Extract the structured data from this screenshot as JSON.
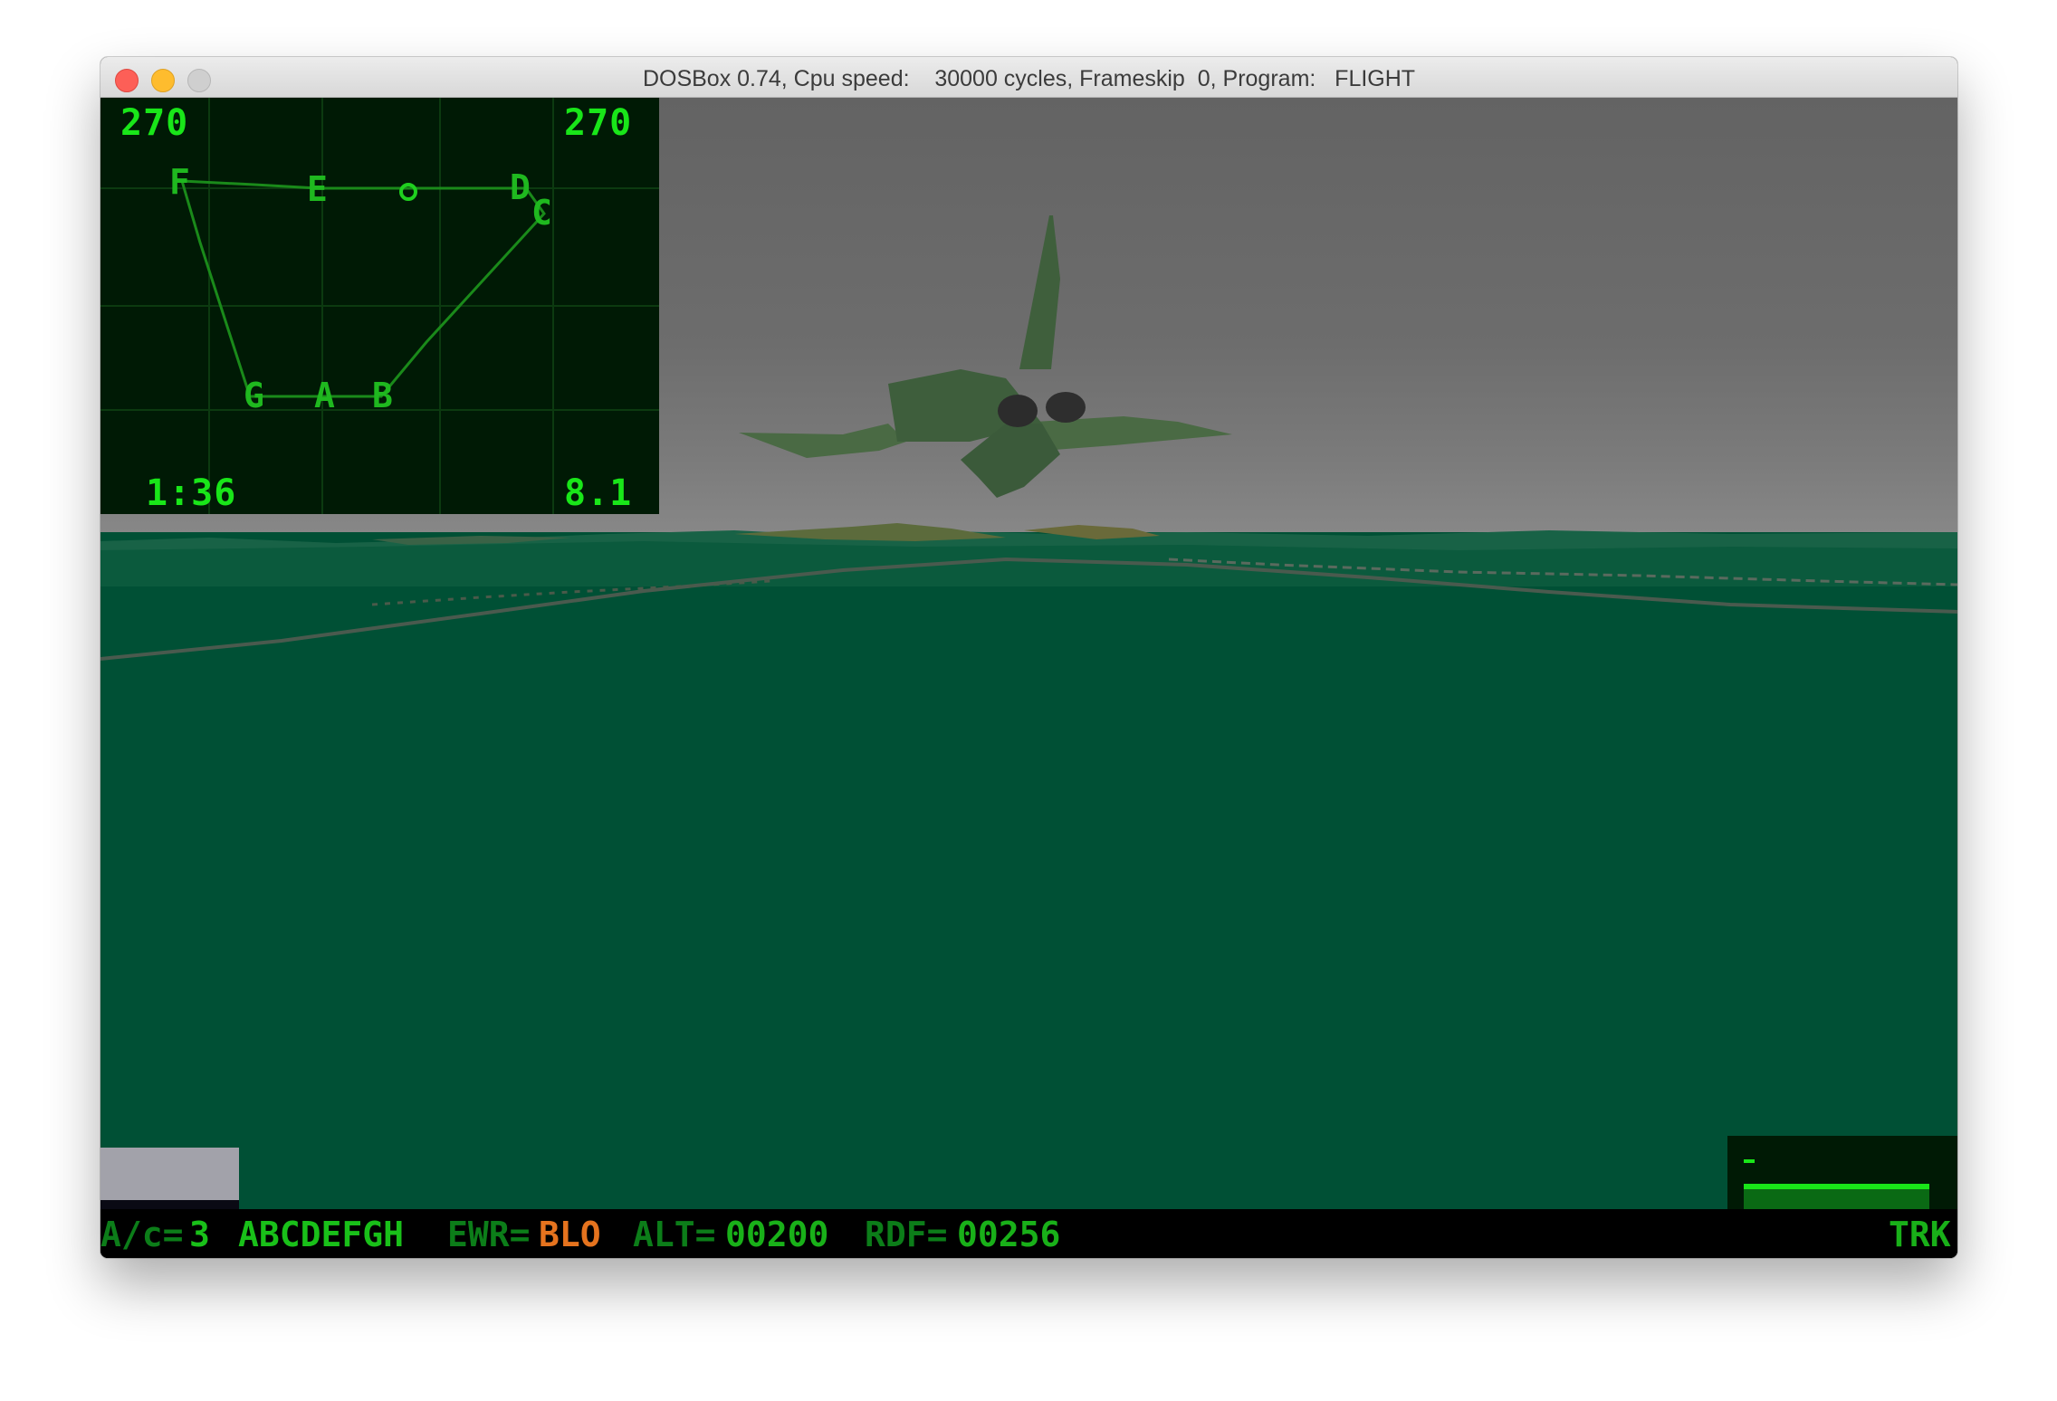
{
  "window": {
    "title": "DOSBox 0.74, Cpu speed:    30000 cycles, Frameskip  0, Program:   FLIGHT"
  },
  "map_panel": {
    "heading_left": "270",
    "heading_right": "270",
    "time": "1:36",
    "value": "8.1",
    "waypoints": [
      "F",
      "E",
      "D",
      "C",
      "G",
      "A",
      "B"
    ]
  },
  "status_bar": {
    "aircraft_label": "A/c=",
    "aircraft_value": "3",
    "weapons": "ABCDEFGH",
    "ewr_label": "EWR=",
    "ewr_value": "BLO",
    "alt_label": "ALT=",
    "alt_value": "00200",
    "rdf_label": "RDF=",
    "rdf_value": "00256",
    "mode": "TRK"
  },
  "colors": {
    "hud_green": "#19e619",
    "status_green": "#0c7d19",
    "warning_orange": "#e5731e",
    "sky": "#6a6a6a",
    "ground": "#005035",
    "aircraft": "#3b6a3c"
  }
}
